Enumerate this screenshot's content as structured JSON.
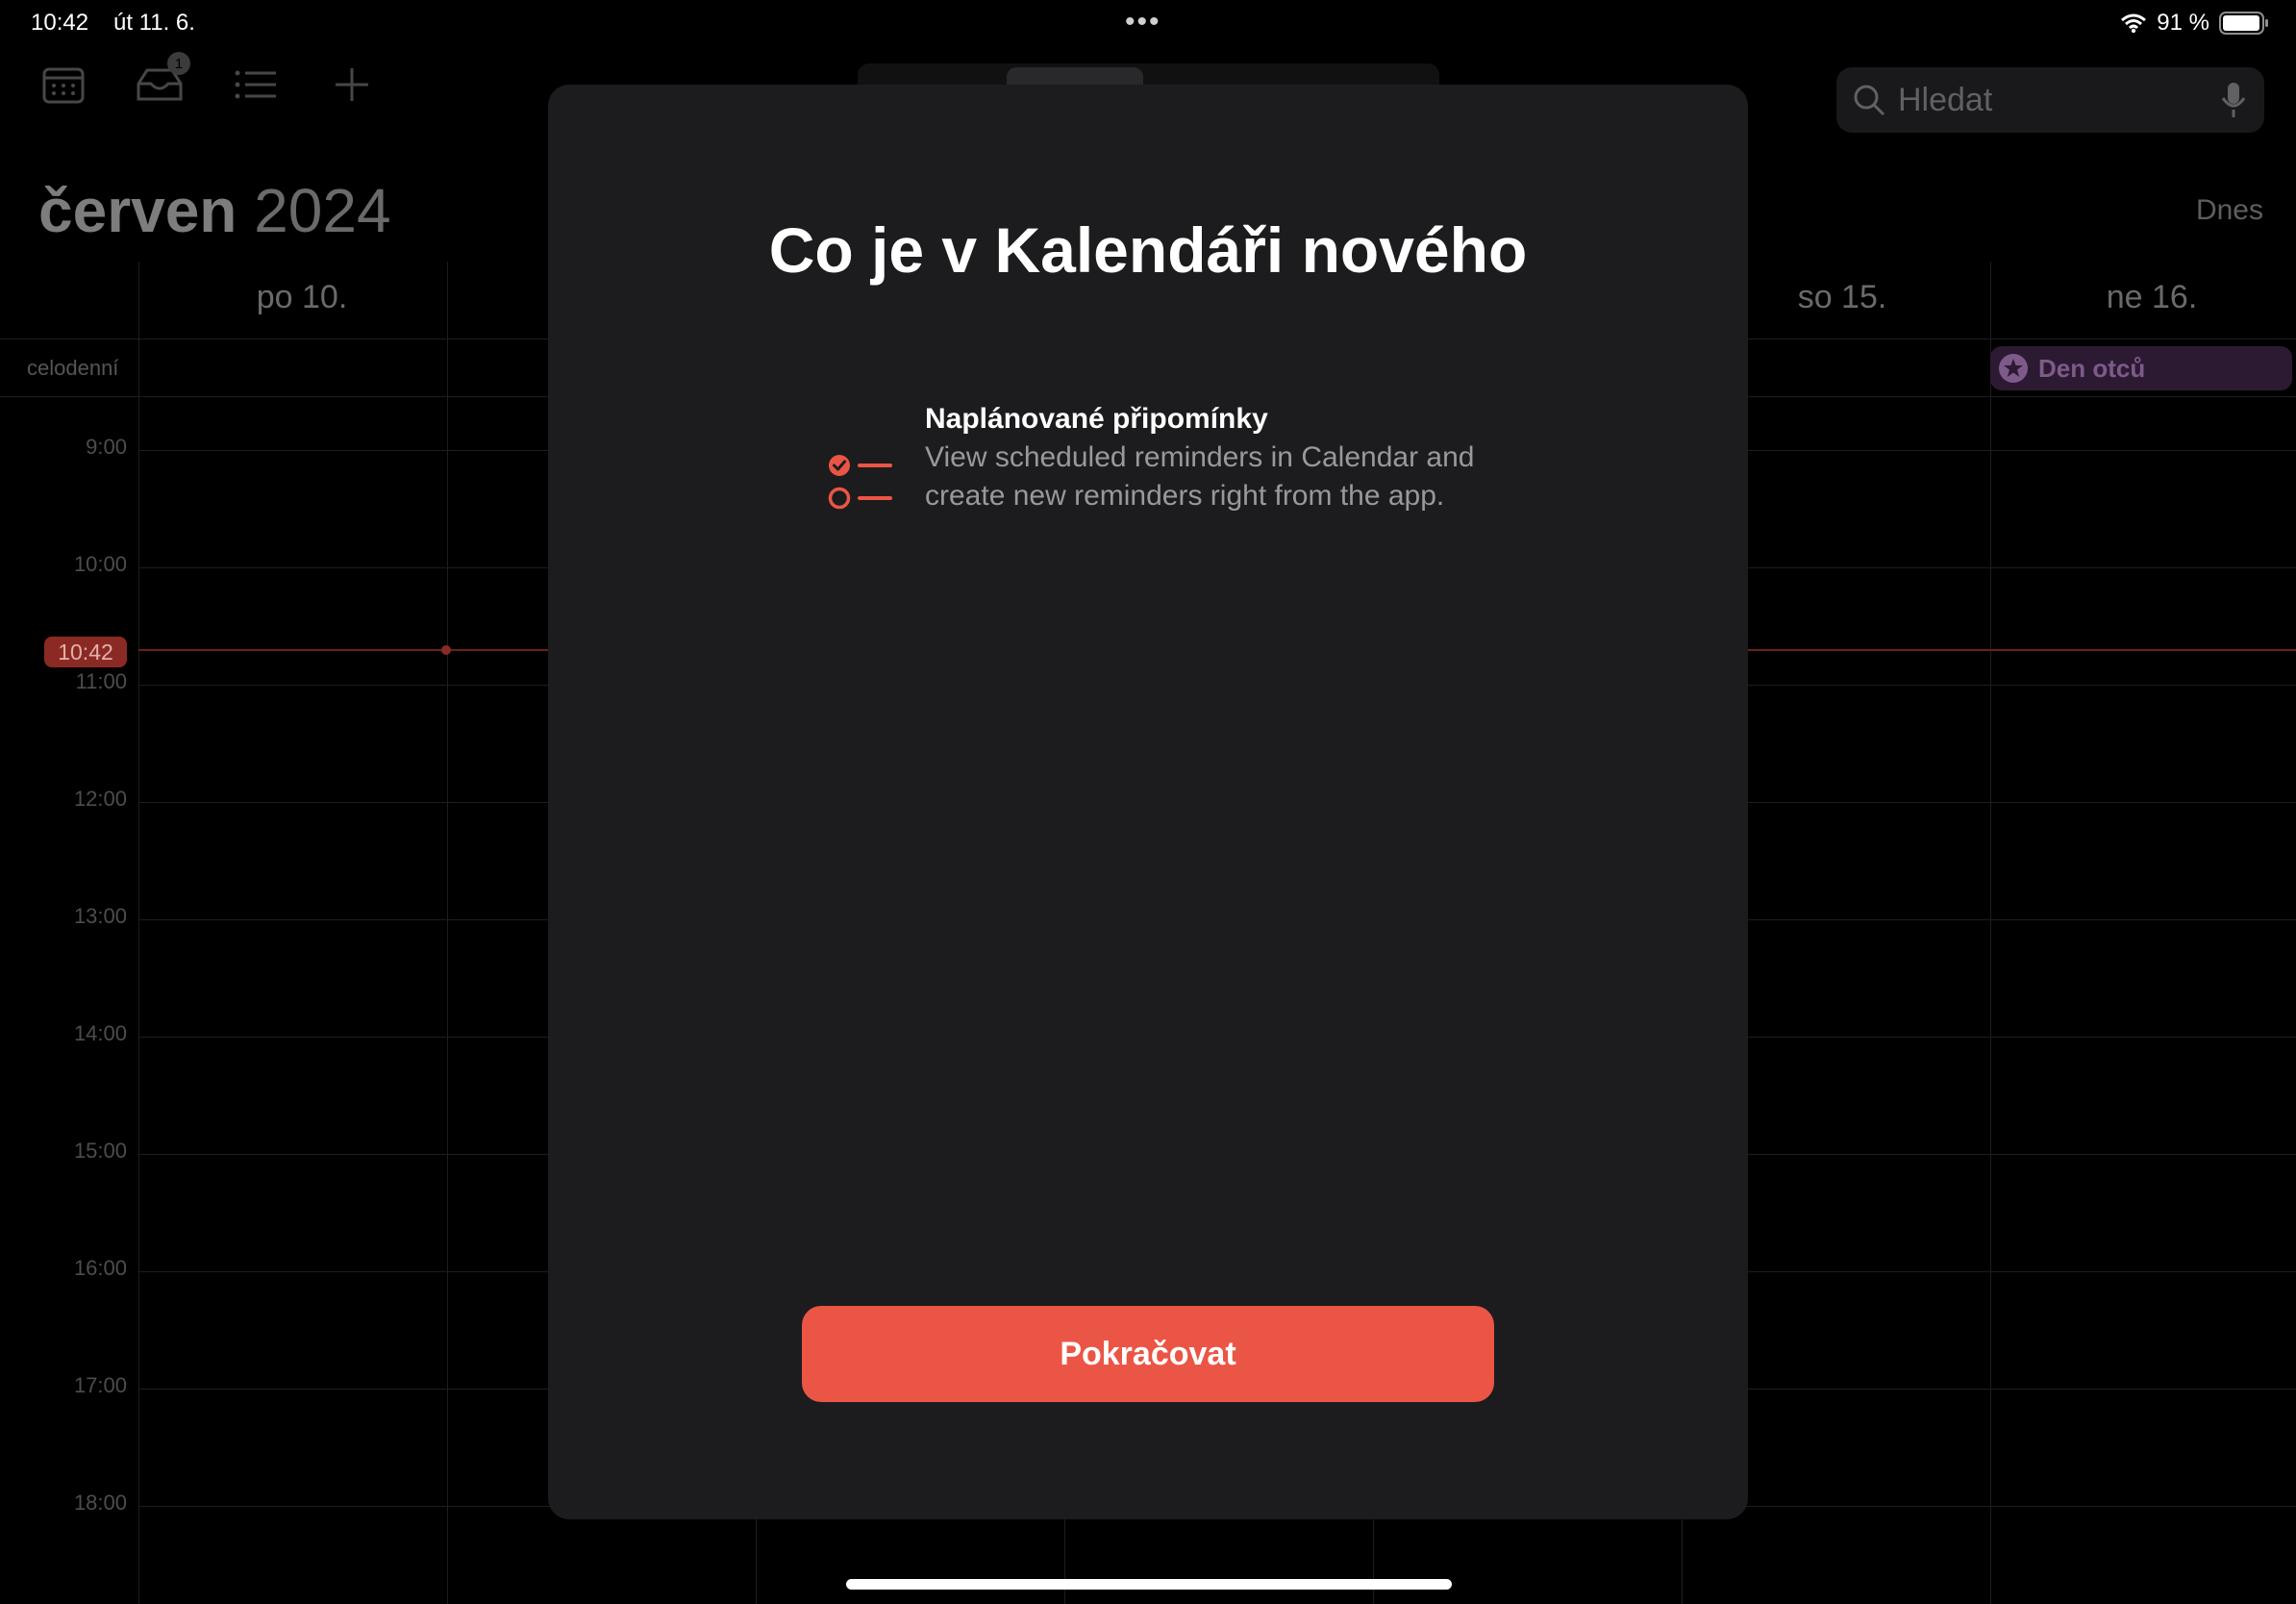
{
  "status_bar": {
    "time": "10:42",
    "date": "út 11. 6.",
    "battery_text": "91 %"
  },
  "toolbar": {
    "icons": [
      "calendar-icon",
      "inbox-icon",
      "list-icon",
      "plus-icon"
    ],
    "inbox_badge": "1"
  },
  "search": {
    "placeholder": "Hledat"
  },
  "header": {
    "month": "červen",
    "year": "2024",
    "today_label": "Dnes"
  },
  "week": {
    "days": [
      "po 10.",
      "so 15.",
      "ne 16."
    ],
    "allday_label": "celodenní",
    "hours": [
      "9:00",
      "10:00",
      "11:00",
      "12:00",
      "13:00",
      "14:00",
      "15:00",
      "16:00",
      "17:00",
      "18:00"
    ],
    "current_time": "10:42",
    "event": {
      "label": "Den otců",
      "color": "#bf5af2"
    }
  },
  "modal": {
    "title": "Co je v Kalendáři nového",
    "feature": {
      "title": "Naplánované připomínky",
      "description": "View scheduled reminders in Calendar and create new reminders right from the app.",
      "icon": "reminders-list-icon"
    },
    "continue_label": "Pokračovat",
    "accent_color": "#eb5545"
  }
}
